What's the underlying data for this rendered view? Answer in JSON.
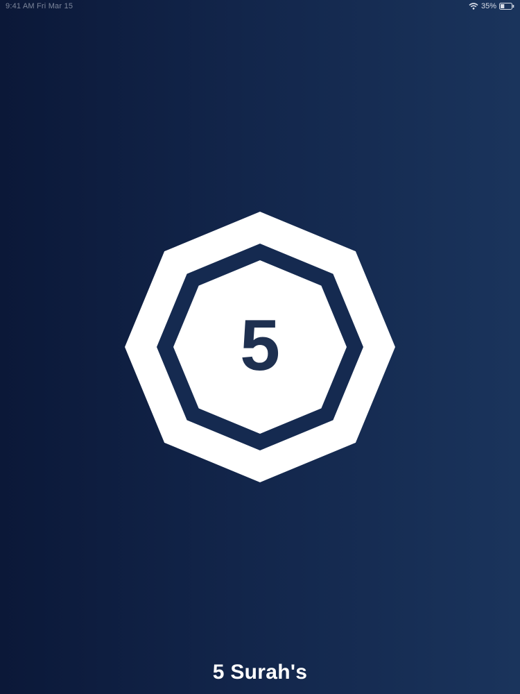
{
  "status_bar": {
    "left_text": "9:41 AM   Fri Mar 15",
    "battery_percent": "35%",
    "battery_level": 0.35
  },
  "logo": {
    "numeral": "5",
    "shape": "eight-pointed-star-icon",
    "colors": {
      "fill": "#ffffff",
      "inner_line": "#152a50",
      "numeral": "#1e3050"
    }
  },
  "app": {
    "name": "5 Surah's"
  },
  "colors": {
    "background_left": "#0b1838",
    "background_right": "#1a345c",
    "text": "#ffffff"
  }
}
